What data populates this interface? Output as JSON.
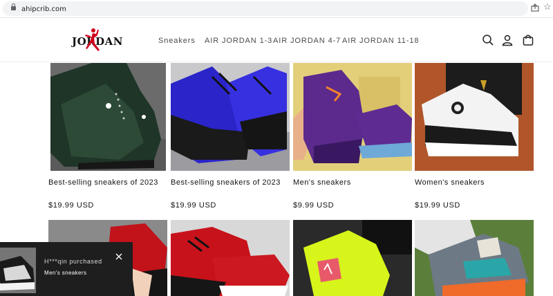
{
  "browser": {
    "url": "ahipcrib.com"
  },
  "header": {
    "logo_text": "JORDAN",
    "nav": [
      "Sneakers",
      "AIR JORDAN 1-3",
      "AIR JORDAN 4-7",
      "AIR JORDAN 11-18"
    ],
    "icons": [
      "search-icon",
      "account-icon",
      "cart-icon"
    ]
  },
  "products": [
    {
      "title": "Best-selling sneakers of 2023",
      "price": "$19.99 USD"
    },
    {
      "title": "Best-selling sneakers of 2023",
      "price": "$19.99 USD"
    },
    {
      "title": "Men's sneakers",
      "price": "$9.99 USD"
    },
    {
      "title": "Women's sneakers",
      "price": "$19.99 USD"
    }
  ],
  "popup": {
    "line1": "H***qin purchased",
    "line2": "Men's sneakers"
  },
  "colors": {
    "text": "#121212",
    "nav": "#4a4a4a",
    "logo_red": "#d0021b",
    "popup_bg": "#1e1e1e"
  }
}
